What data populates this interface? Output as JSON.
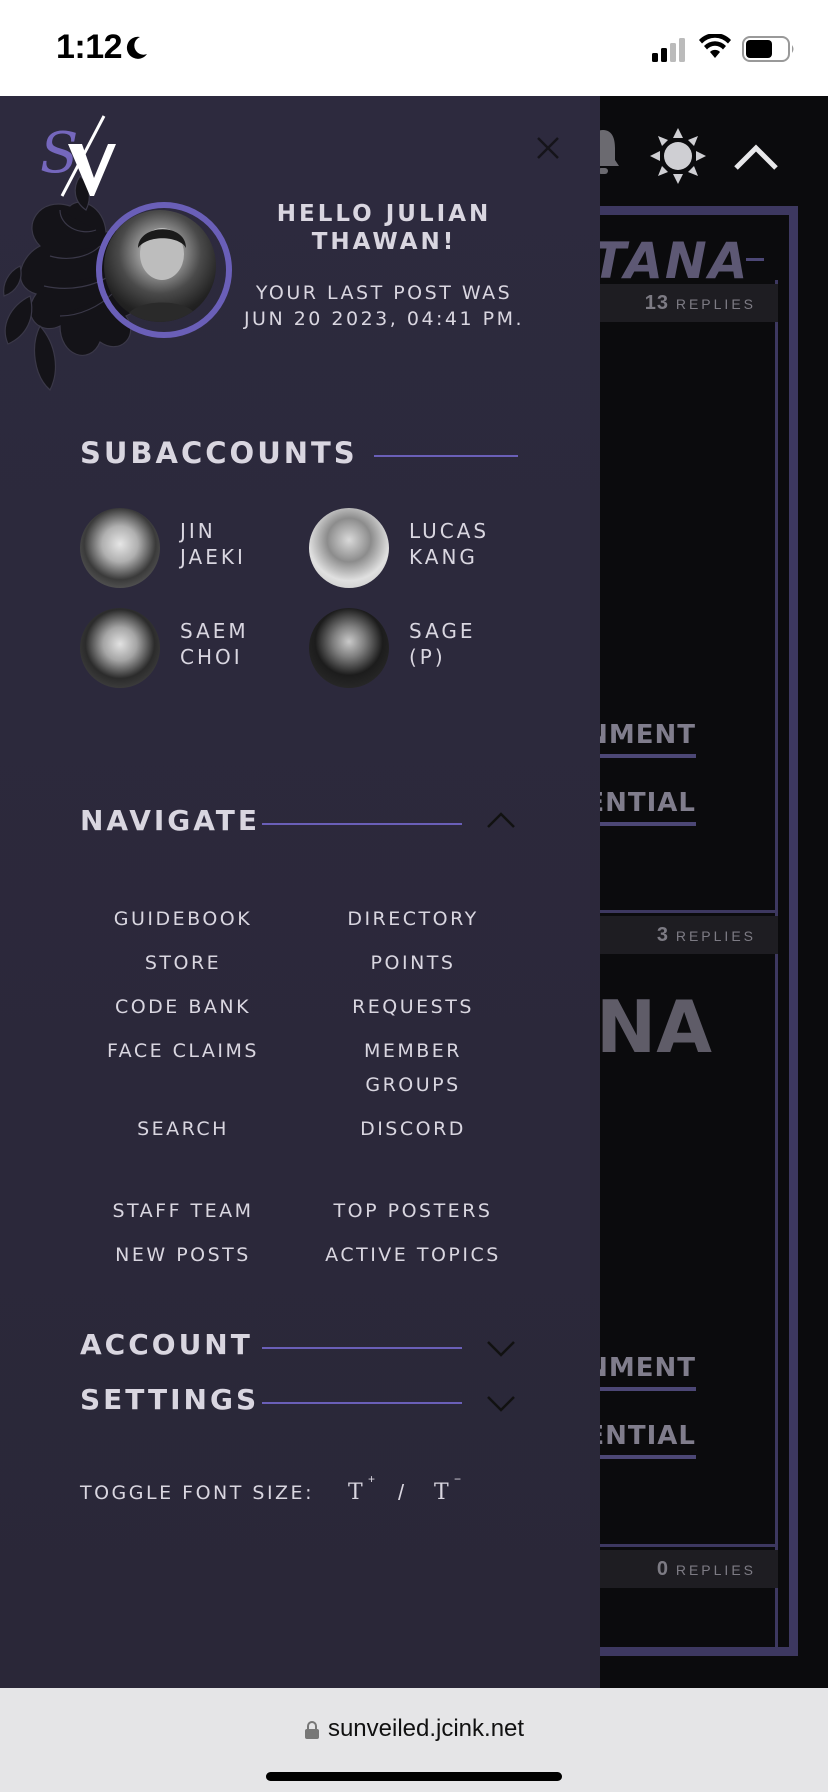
{
  "status_bar": {
    "time": "1:12"
  },
  "background_page": {
    "title_fragment": "TANA",
    "big_fragment": "NA",
    "reply_rows": [
      {
        "count": "13",
        "label": "REPLIES"
      },
      {
        "count": "3",
        "label": "REPLIES"
      },
      {
        "count": "0",
        "label": "REPLIES"
      }
    ],
    "links": [
      "NMENT",
      "ENTIAL",
      "NMENT",
      "ENTIAL"
    ]
  },
  "drawer": {
    "logo_text": "S",
    "greeting": "HELLO JULIAN THAWAN!",
    "last_post": "YOUR LAST POST WAS JUN 20 2023, 04:41 PM.",
    "subaccounts": {
      "heading": "SUBACCOUNTS",
      "items": [
        {
          "name_line1": "JIN",
          "name_line2": "JAEKI"
        },
        {
          "name_line1": "LUCAS",
          "name_line2": "KANG"
        },
        {
          "name_line1": "SAEM",
          "name_line2": "CHOI"
        },
        {
          "name_line1": "SAGE",
          "name_line2": "(P)"
        }
      ]
    },
    "navigate": {
      "heading": "NAVIGATE",
      "links": [
        "GUIDEBOOK",
        "DIRECTORY",
        "STORE",
        "POINTS",
        "CODE BANK",
        "REQUESTS",
        "FACE CLAIMS",
        "MEMBER GROUPS",
        "SEARCH",
        "DISCORD",
        "STAFF TEAM",
        "TOP POSTERS",
        "NEW POSTS",
        "ACTIVE TOPICS"
      ]
    },
    "account": {
      "heading": "ACCOUNT"
    },
    "settings": {
      "heading": "SETTINGS"
    },
    "font_toggle": {
      "label": "TOGGLE FONT SIZE:",
      "increase": "T",
      "increase_sup": "+",
      "separator": "/",
      "decrease": "T",
      "decrease_sup": "−"
    }
  },
  "browser": {
    "url": "sunveiled.jcink.net"
  },
  "colors": {
    "accent": "#6a5fb8",
    "drawer_bg": "#2d2a3e",
    "text": "#d9d6e0"
  }
}
